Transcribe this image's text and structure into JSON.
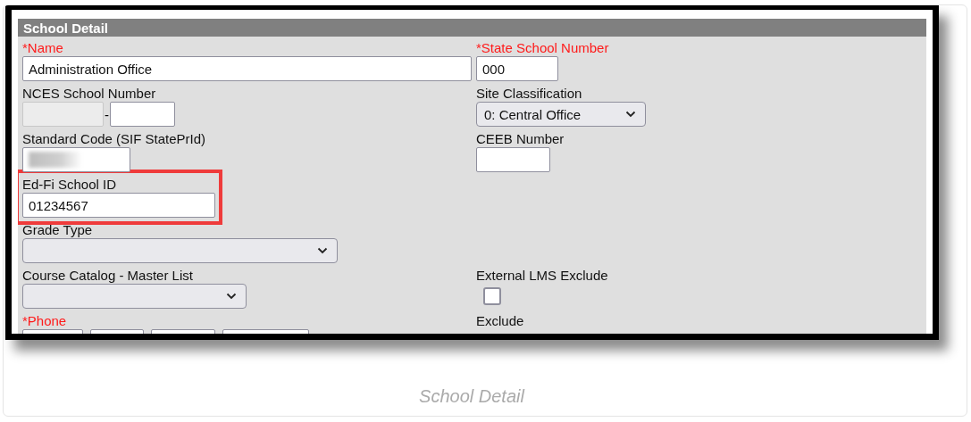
{
  "panel": {
    "title": "School Detail"
  },
  "rows": [
    {
      "left": {
        "kind": "text",
        "label": "*Name",
        "required": true,
        "value": "Administration Office"
      },
      "right": {
        "kind": "text",
        "label": "*State School Number",
        "required": true,
        "value": "000"
      }
    },
    {
      "left": {
        "kind": "split",
        "label": "NCES School Number",
        "required": false,
        "separator": "-",
        "parts": [
          {
            "disabled": true
          },
          {
            "disabled": false
          }
        ]
      },
      "right": {
        "kind": "select",
        "label": "Site Classification",
        "required": false,
        "value": "0: Central Office"
      }
    },
    {
      "left": {
        "kind": "text",
        "label": "Standard Code (SIF StatePrId)",
        "required": false,
        "redacted": true
      },
      "right": {
        "kind": "text",
        "label": "CEEB Number",
        "required": false
      }
    },
    {
      "left": {
        "kind": "text",
        "label": "Ed-Fi School ID",
        "required": false,
        "value": "01234567",
        "highlighted": true
      }
    },
    {
      "left": {
        "kind": "select",
        "label": "Grade Type",
        "required": false
      }
    },
    {
      "left": {
        "kind": "select",
        "label": "Course Catalog - Master List",
        "required": false
      },
      "right": {
        "kind": "checkbox",
        "label": "External LMS Exclude",
        "required": false,
        "checked": false
      }
    },
    {
      "left": {
        "kind": "phone",
        "label": "*Phone",
        "required": true,
        "parts": [
          {
            "disabled": false
          },
          {
            "disabled": false
          },
          {
            "disabled": false
          },
          {
            "disabled": false
          }
        ]
      },
      "right": {
        "kind": "label",
        "label": "Exclude",
        "required": false
      }
    }
  ],
  "caption": "School Detail"
}
